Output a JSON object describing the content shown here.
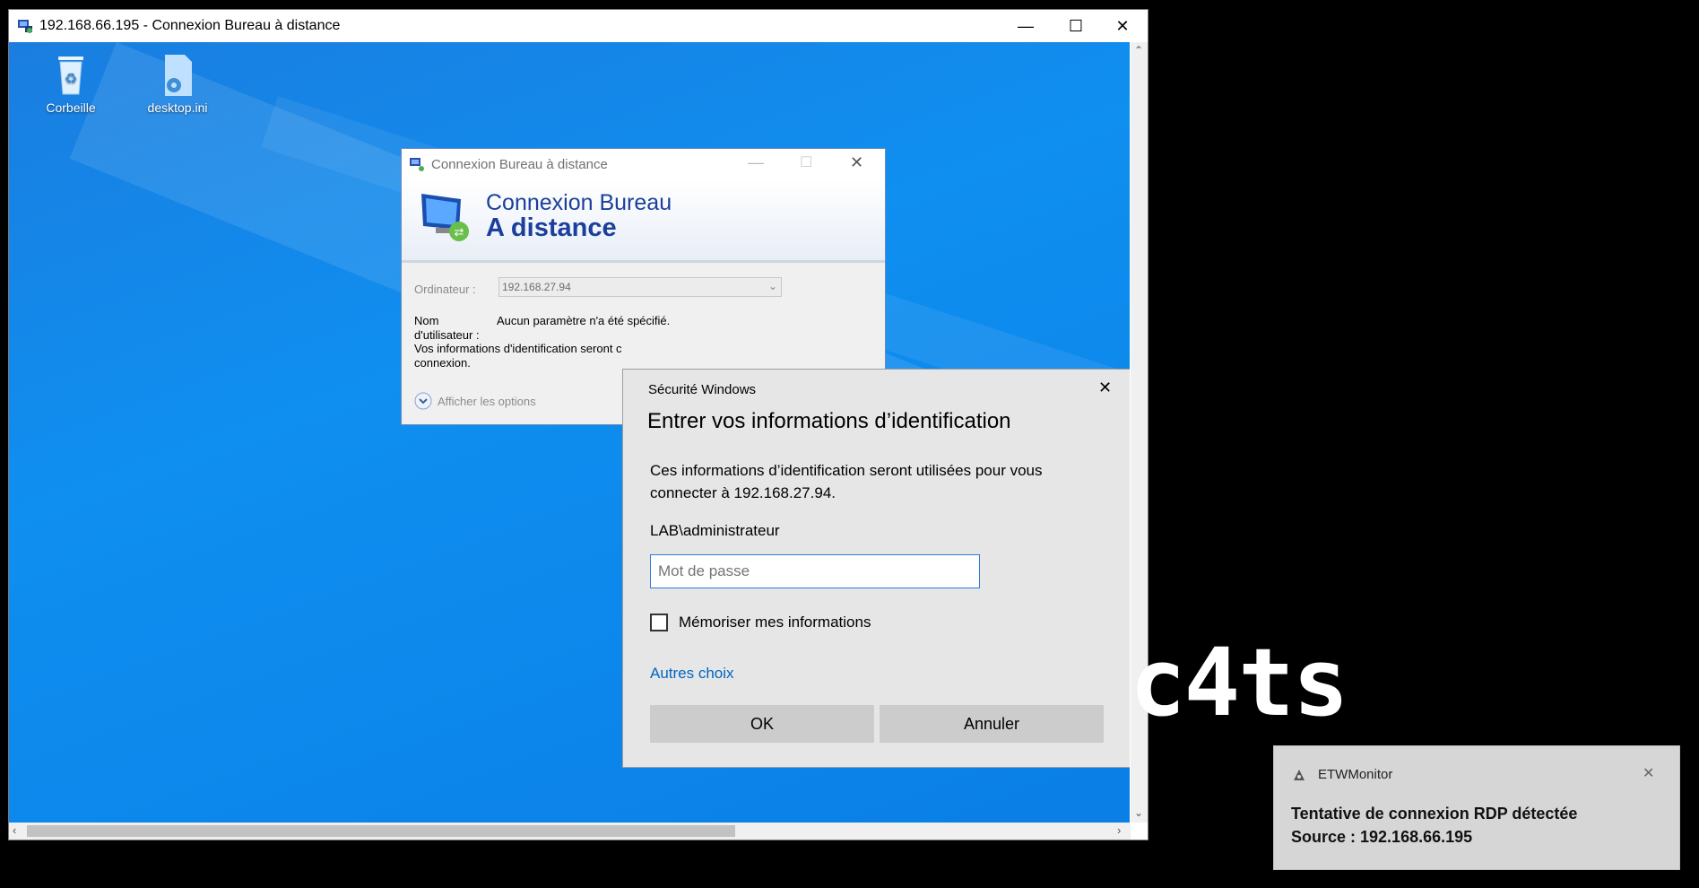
{
  "rdp_window": {
    "title": "192.168.66.195 - Connexion Bureau à distance",
    "controls": {
      "minimize": "—",
      "maximize": "☐",
      "close": "✕"
    }
  },
  "desktop": {
    "icons": [
      {
        "label": "Corbeille",
        "icon": "recycle-bin-icon"
      },
      {
        "label": "desktop.ini",
        "icon": "settings-file-icon"
      }
    ]
  },
  "rdc_dialog": {
    "title": "Connexion Bureau à distance",
    "banner_line1": "Connexion Bureau",
    "banner_line2": "A distance",
    "computer_label": "Ordinateur :",
    "computer_value": "192.168.27.94",
    "username_label": "Nom\nd'utilisateur :",
    "username_value": "Aucun paramètre n'a été spécifié.",
    "info_text": "Vos informations d'identification seront c",
    "info_text2": "connexion.",
    "options_label": "Afficher les options"
  },
  "security_dialog": {
    "window_title": "Sécurité Windows",
    "heading": "Entrer vos informations d’identification",
    "description": "Ces informations d’identification seront utilisées pour vous connecter à 192.168.27.94.",
    "username": "LAB\\administrateur",
    "password_placeholder": "Mot de passe",
    "password_value": "",
    "remember_label": "Mémoriser mes informations",
    "remember_checked": false,
    "other_choices": "Autres choix",
    "ok_label": "OK",
    "cancel_label": "Annuler",
    "close": "✕"
  },
  "logo_text": "c4ts",
  "toast": {
    "app": "ETWMonitor",
    "line1": "Tentative de connexion RDP détectée",
    "line2": "Source : 192.168.66.195",
    "close": "✕"
  },
  "colors": {
    "desktop_blue": "#0f8ff0",
    "link_blue": "#0067c0",
    "banner_blue": "#1b3f9a"
  }
}
